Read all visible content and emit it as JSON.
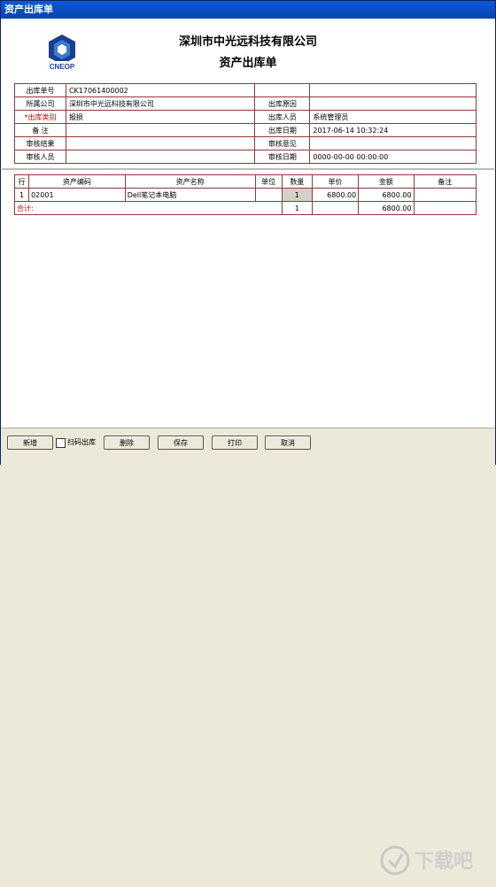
{
  "window": {
    "title": "资产出库单"
  },
  "header": {
    "company": "深圳市中光远科技有限公司",
    "title": "资产出库单",
    "logo_text": "CNEOP"
  },
  "info": {
    "row1": {
      "label1": "出库单号",
      "value1": "CK17061400002",
      "label2": "",
      "value2": ""
    },
    "row2": {
      "label1": "所属公司",
      "value1": "深圳市中光远科技有限公司",
      "label2": "出库原因",
      "value2": ""
    },
    "row3": {
      "label1": "*出库类别",
      "value1": "报损",
      "label2": "出库人员",
      "value2": "系统管理员"
    },
    "row4": {
      "label1": "备  注",
      "value1": "",
      "label2": "出库日期",
      "value2": "2017-06-14 10:32:24"
    },
    "row5": {
      "label1": "审核结果",
      "value1": "",
      "label2": "审核意见",
      "value2": ""
    },
    "row6": {
      "label1": "审核人员",
      "value1": "",
      "label2": "审核日期",
      "value2": "0000-00-00 00:00:00"
    }
  },
  "items": {
    "headers": {
      "row": "行",
      "code": "资产编码",
      "name": "资产名称",
      "unit": "单位",
      "qty": "数量",
      "price": "单价",
      "amount": "金额",
      "note": "备注"
    },
    "rows": [
      {
        "row": "1",
        "code": "02001",
        "name": "Dell笔记本电脑",
        "unit": "",
        "qty": "1",
        "price": "6800.00",
        "amount": "6800.00",
        "note": ""
      }
    ],
    "total": {
      "label": "合计:",
      "qty": "1",
      "amount": "6800.00"
    }
  },
  "toolbar": {
    "add": "新增",
    "scan_out": "扫码出库",
    "delete": "删除",
    "save": "保存",
    "print": "打印",
    "cancel": "取消"
  },
  "watermark": {
    "text": "下载吧"
  }
}
